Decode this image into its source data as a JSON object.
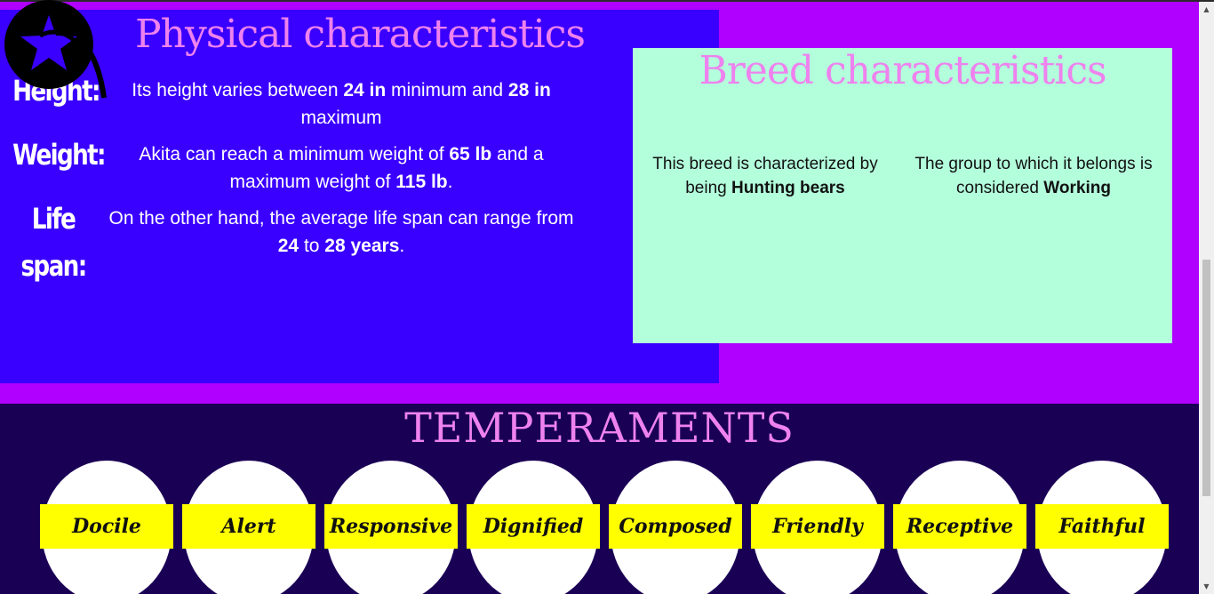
{
  "physical": {
    "title": "Physical characteristics",
    "height": {
      "label": "Height:",
      "text_1": "Its height varies between ",
      "min": "24 in",
      "text_2": " minimum and ",
      "max": "28 in",
      "text_3": " maximum"
    },
    "weight": {
      "label": "Weight:",
      "text_1": "Akita can reach a minimum weight of ",
      "min": "65 lb",
      "text_2": " and a maximum weight of ",
      "max": "115 lb",
      "text_3": "."
    },
    "lifespan": {
      "label": "Life span:",
      "text_1": "On the other hand, the average life span can range from ",
      "min": "24",
      "text_2": " to ",
      "max": "28 years",
      "text_3": "."
    }
  },
  "breed": {
    "title": "Breed characteristics",
    "characterized_text": "This breed is characterized by being ",
    "characterized_value": "Hunting bears",
    "group_text": "The group to which it belongs is considered ",
    "group_value": "Working"
  },
  "temperaments": {
    "title": "TEMPERAMENTS",
    "items": [
      "Docile",
      "Alert",
      "Responsive",
      "Dignified",
      "Composed",
      "Friendly",
      "Receptive",
      "Faithful"
    ]
  },
  "colors": {
    "page_bg": "#b000ff",
    "physical_bg": "#3a00ff",
    "breed_bg": "#b3ffdc",
    "temperaments_bg": "#1a0055",
    "title_pink": "#ee82ee",
    "pill_yellow": "#ffff00"
  },
  "icons": {
    "logo": "star-logo-icon"
  }
}
